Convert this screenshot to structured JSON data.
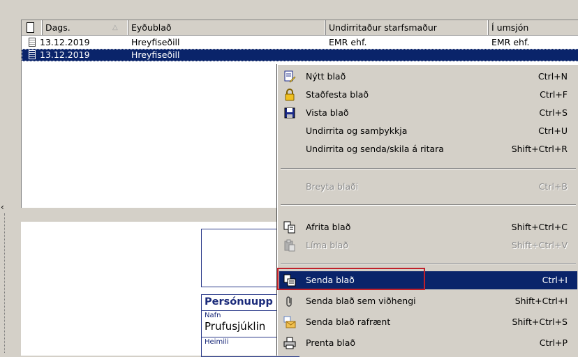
{
  "list": {
    "columns": [
      "Dags.",
      "Eyðublað",
      "Undirritaður starfsmaður",
      "Í umsjón"
    ],
    "rows": [
      {
        "date": "13.12.2019",
        "form": "Hreyfiseðill",
        "signed_by": "EMR ehf.",
        "in_charge": "EMR ehf.",
        "icon": "signed-document-icon"
      },
      {
        "date": "13.12.2019",
        "form": "Hreyfiseðill",
        "signed_by": "",
        "in_charge": "",
        "icon": "document-icon"
      }
    ]
  },
  "preview": {
    "section_title": "Persónuupp",
    "name_label": "Nafn",
    "name_value": "Prufusjúklin",
    "address_label": "Heimili"
  },
  "context_menu": {
    "items": [
      {
        "label": "Nýtt blað",
        "shortcut": "Ctrl+N",
        "icon": "new-sheet-icon",
        "enabled": true
      },
      {
        "label": "Staðfesta blað",
        "shortcut": "Ctrl+F",
        "icon": "lock-icon",
        "enabled": true
      },
      {
        "label": "Vista blað",
        "shortcut": "Ctrl+S",
        "icon": "save-icon",
        "enabled": true
      },
      {
        "label": "Undirrita og samþykkja",
        "shortcut": "Ctrl+U",
        "icon": "",
        "enabled": true
      },
      {
        "label": "Undirrita og senda/skila á ritara",
        "shortcut": "Shift+Ctrl+R",
        "icon": "",
        "enabled": true
      },
      {
        "label": "Breyta blaði",
        "shortcut": "Ctrl+B",
        "icon": "",
        "enabled": false
      },
      {
        "label": "Afrita blað",
        "shortcut": "Shift+Ctrl+C",
        "icon": "copy-icon",
        "enabled": true
      },
      {
        "label": "Líma blað",
        "shortcut": "Shift+Ctrl+V",
        "icon": "paste-icon",
        "enabled": false
      },
      {
        "label": "Senda blað",
        "shortcut": "Ctrl+I",
        "icon": "send-icon",
        "enabled": true,
        "highlighted": true
      },
      {
        "label": "Senda blað sem viðhengi",
        "shortcut": "Shift+Ctrl+I",
        "icon": "paperclip-icon",
        "enabled": true
      },
      {
        "label": "Senda blað rafrænt",
        "shortcut": "Shift+Ctrl+S",
        "icon": "envelope-icon",
        "enabled": true
      },
      {
        "label": "Prenta blað",
        "shortcut": "Ctrl+P",
        "icon": "printer-icon",
        "enabled": true
      }
    ]
  },
  "colors": {
    "selection": "#0a246a",
    "callout": "#c0202a",
    "form_border": "#2a3a8a"
  }
}
